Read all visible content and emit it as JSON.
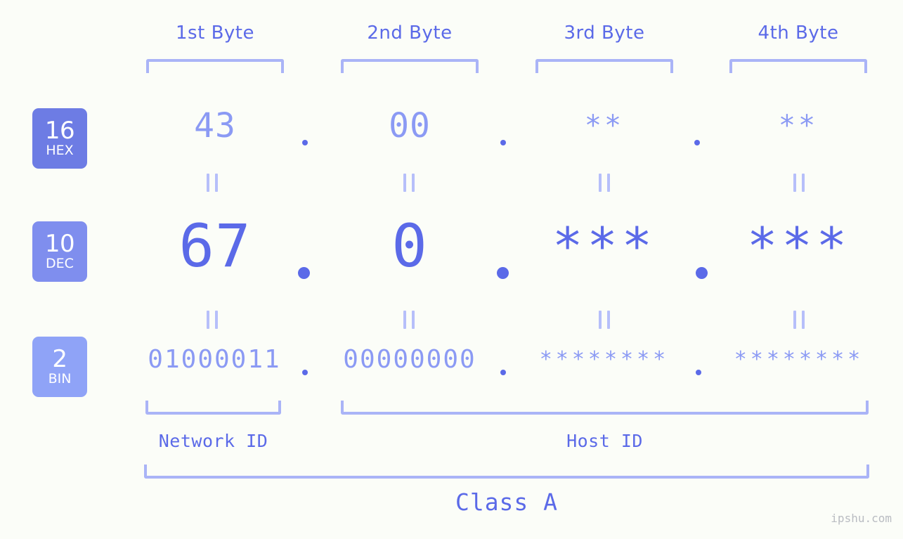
{
  "meta": {
    "watermark": "ipshu.com",
    "background_color": "#fbfdf8",
    "accent_dark": "#5b6ae8",
    "accent_mid": "#8b9af4",
    "accent_light": "#aab4f7"
  },
  "headers": {
    "byte1": "1st Byte",
    "byte2": "2nd Byte",
    "byte3": "3rd Byte",
    "byte4": "4th Byte"
  },
  "bases": [
    {
      "number": "16",
      "label": "HEX",
      "color": "#6d7ce4"
    },
    {
      "number": "10",
      "label": "DEC",
      "color": "#7f8eee"
    },
    {
      "number": "2",
      "label": "BIN",
      "color": "#8fa3f7"
    }
  ],
  "rows": {
    "hex": {
      "byte1": "43",
      "byte2": "00",
      "byte3": "**",
      "byte4": "**"
    },
    "dec": {
      "byte1": "67",
      "byte2": "0",
      "byte3": "***",
      "byte4": "***"
    },
    "bin": {
      "byte1": "01000011",
      "byte2": "00000000",
      "byte3": "********",
      "byte4": "********"
    }
  },
  "separators": {
    "dot": ".",
    "equals": "||"
  },
  "footer": {
    "network_id": "Network ID",
    "host_id": "Host ID",
    "class": "Class A"
  }
}
